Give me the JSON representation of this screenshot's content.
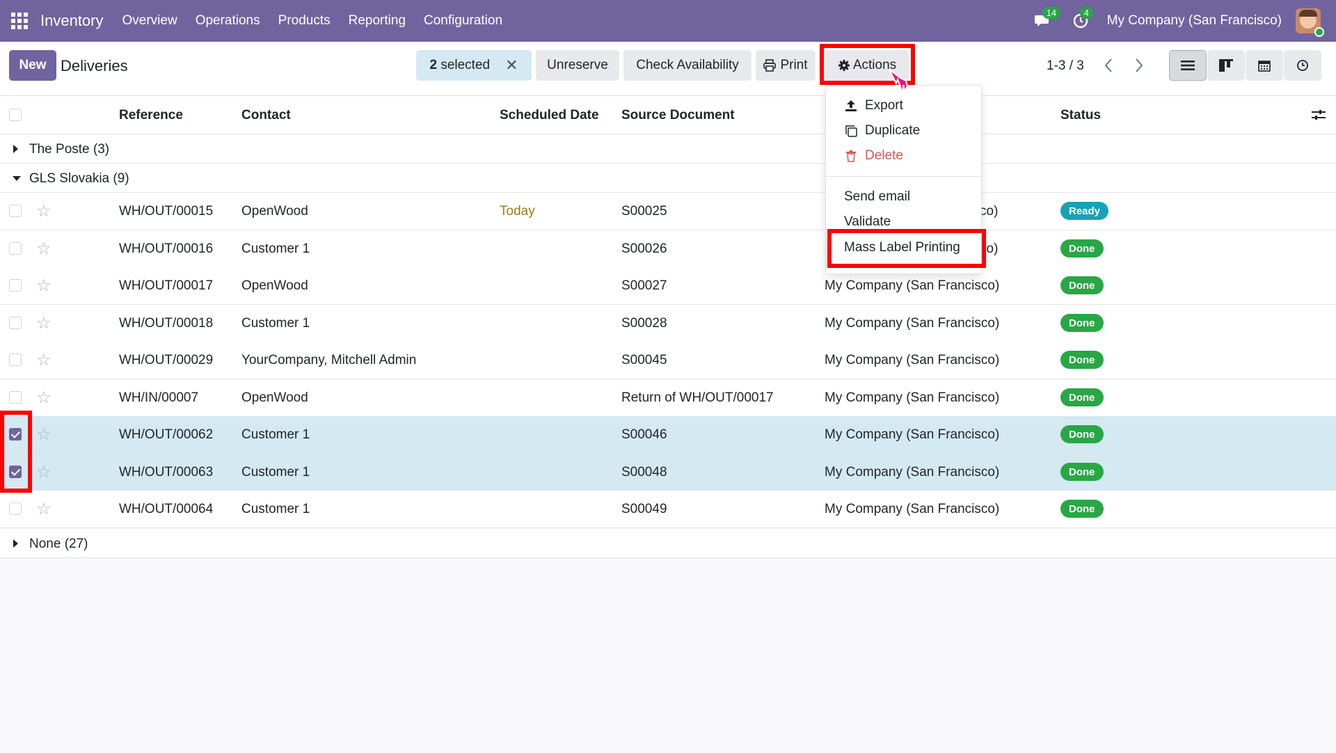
{
  "navbar": {
    "app_name": "Inventory",
    "menu": [
      "Overview",
      "Operations",
      "Products",
      "Reporting",
      "Configuration"
    ],
    "messages_count": "14",
    "activities_count": "4",
    "company": "My Company (San Francisco)"
  },
  "control_panel": {
    "new_label": "New",
    "title": "Deliveries",
    "selected_count": "2",
    "selected_label": "selected",
    "unreserve_label": "Unreserve",
    "check_availability_label": "Check Availability",
    "print_label": "Print",
    "actions_label": "Actions",
    "pager": "1-3 / 3"
  },
  "table": {
    "headers": {
      "reference": "Reference",
      "contact": "Contact",
      "scheduled_date": "Scheduled Date",
      "source_document": "Source Document",
      "status": "Status"
    },
    "groups": [
      {
        "label": "The Poste (3)",
        "expanded": false
      },
      {
        "label": "GLS Slovakia (9)",
        "expanded": true
      },
      {
        "label": "None (27)",
        "expanded": false
      }
    ],
    "rows": [
      {
        "reference": "WH/OUT/00015",
        "contact": "OpenWood",
        "scheduled": "Today",
        "source": "S00025",
        "company": "co)",
        "status": "Ready",
        "checked": false
      },
      {
        "reference": "WH/OUT/00016",
        "contact": "Customer 1",
        "scheduled": "",
        "source": "S00026",
        "company": "co)",
        "status": "Done",
        "checked": false
      },
      {
        "reference": "WH/OUT/00017",
        "contact": "OpenWood",
        "scheduled": "",
        "source": "S00027",
        "company": "My Company (San Francisco)",
        "status": "Done",
        "checked": false
      },
      {
        "reference": "WH/OUT/00018",
        "contact": "Customer 1",
        "scheduled": "",
        "source": "S00028",
        "company": "My Company (San Francisco)",
        "status": "Done",
        "checked": false
      },
      {
        "reference": "WH/OUT/00029",
        "contact": "YourCompany, Mitchell Admin",
        "scheduled": "",
        "source": "S00045",
        "company": "My Company (San Francisco)",
        "status": "Done",
        "checked": false
      },
      {
        "reference": "WH/IN/00007",
        "contact": "OpenWood",
        "scheduled": "",
        "source": "Return of WH/OUT/00017",
        "company": "My Company (San Francisco)",
        "status": "Done",
        "checked": false
      },
      {
        "reference": "WH/OUT/00062",
        "contact": "Customer 1",
        "scheduled": "",
        "source": "S00046",
        "company": "My Company (San Francisco)",
        "status": "Done",
        "checked": true
      },
      {
        "reference": "WH/OUT/00063",
        "contact": "Customer 1",
        "scheduled": "",
        "source": "S00048",
        "company": "My Company (San Francisco)",
        "status": "Done",
        "checked": true
      },
      {
        "reference": "WH/OUT/00064",
        "contact": "Customer 1",
        "scheduled": "",
        "source": "S00049",
        "company": "My Company (San Francisco)",
        "status": "Done",
        "checked": false
      }
    ]
  },
  "actions_menu": {
    "export": "Export",
    "duplicate": "Duplicate",
    "delete": "Delete",
    "send_email": "Send email",
    "validate": "Validate",
    "mass_label_printing": "Mass Label Printing"
  },
  "colors": {
    "brand": "#71639e",
    "highlight": "#ff0000",
    "done": "#28a745",
    "ready": "#17a2b8",
    "selected_row": "#d4e9f2"
  }
}
